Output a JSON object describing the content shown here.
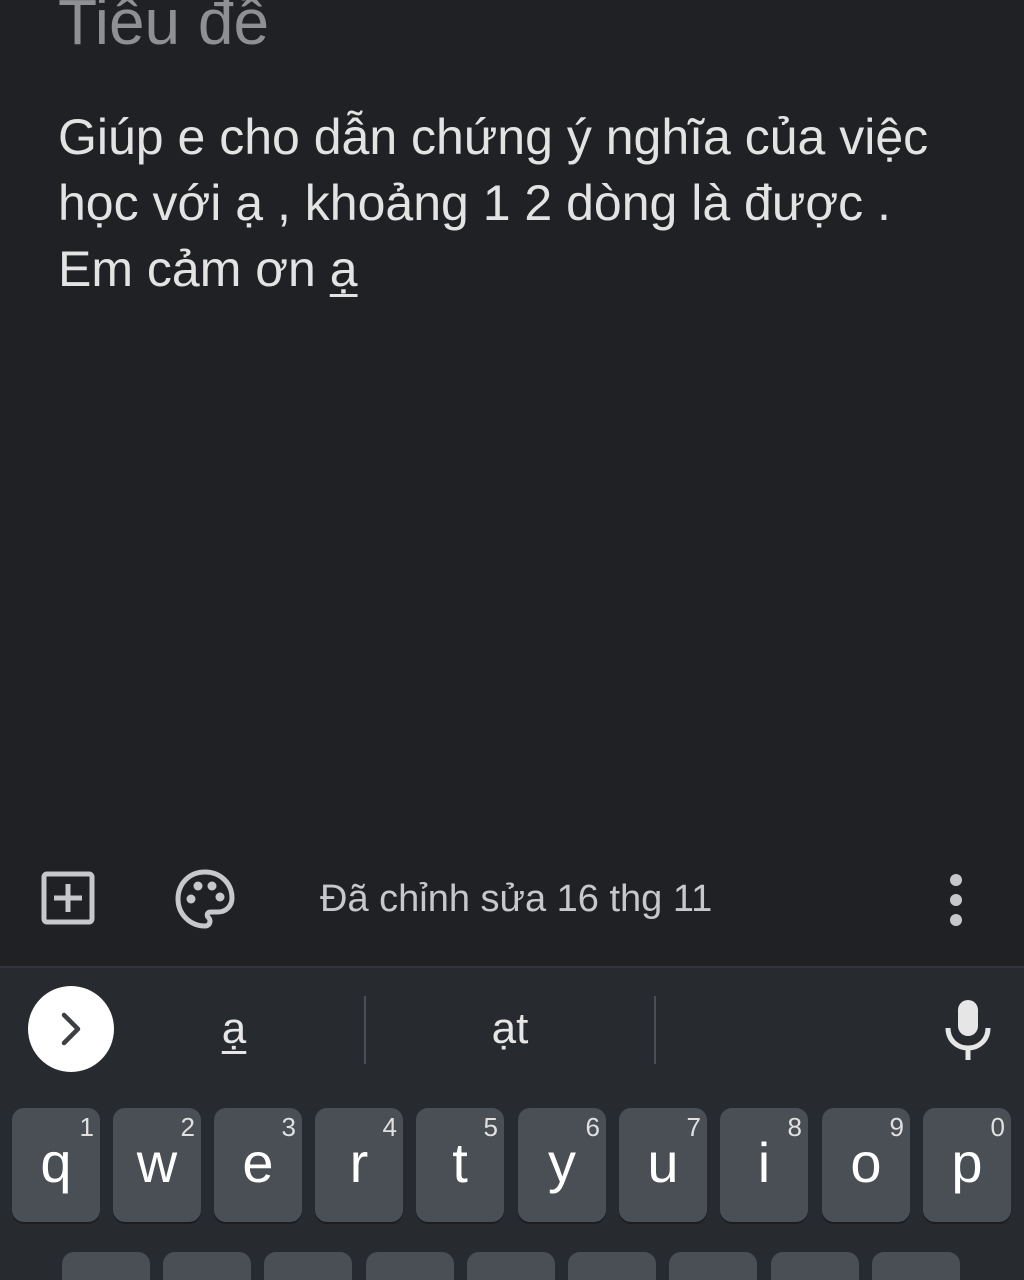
{
  "note": {
    "title_placeholder": "Tiêu đề",
    "body_text": "Giúp e cho dẫn chứng ý nghĩa của việc học với ạ , khoảng 1 2 dòng là được . Em cảm ơn ",
    "composing_word": "ạ"
  },
  "editor_bar": {
    "add_icon": "add-box-icon",
    "palette_icon": "palette-icon",
    "edited_label": "Đã chỉnh sửa 16 thg 11",
    "more_icon": "more-vert-icon"
  },
  "keyboard": {
    "expand_icon": "chevron-right-icon",
    "suggestions": [
      "ạ",
      "ạt"
    ],
    "mic_icon": "mic-icon",
    "row1": [
      {
        "letter": "q",
        "hint": "1"
      },
      {
        "letter": "w",
        "hint": "2"
      },
      {
        "letter": "e",
        "hint": "3"
      },
      {
        "letter": "r",
        "hint": "4"
      },
      {
        "letter": "t",
        "hint": "5"
      },
      {
        "letter": "y",
        "hint": "6"
      },
      {
        "letter": "u",
        "hint": "7"
      },
      {
        "letter": "i",
        "hint": "8"
      },
      {
        "letter": "o",
        "hint": "9"
      },
      {
        "letter": "p",
        "hint": "0"
      }
    ]
  },
  "colors": {
    "background": "#202124",
    "keyboard_bg": "#272b30",
    "key_bg": "#4a4e55",
    "text_primary": "#e3e3e3",
    "text_placeholder": "#8e9094"
  }
}
